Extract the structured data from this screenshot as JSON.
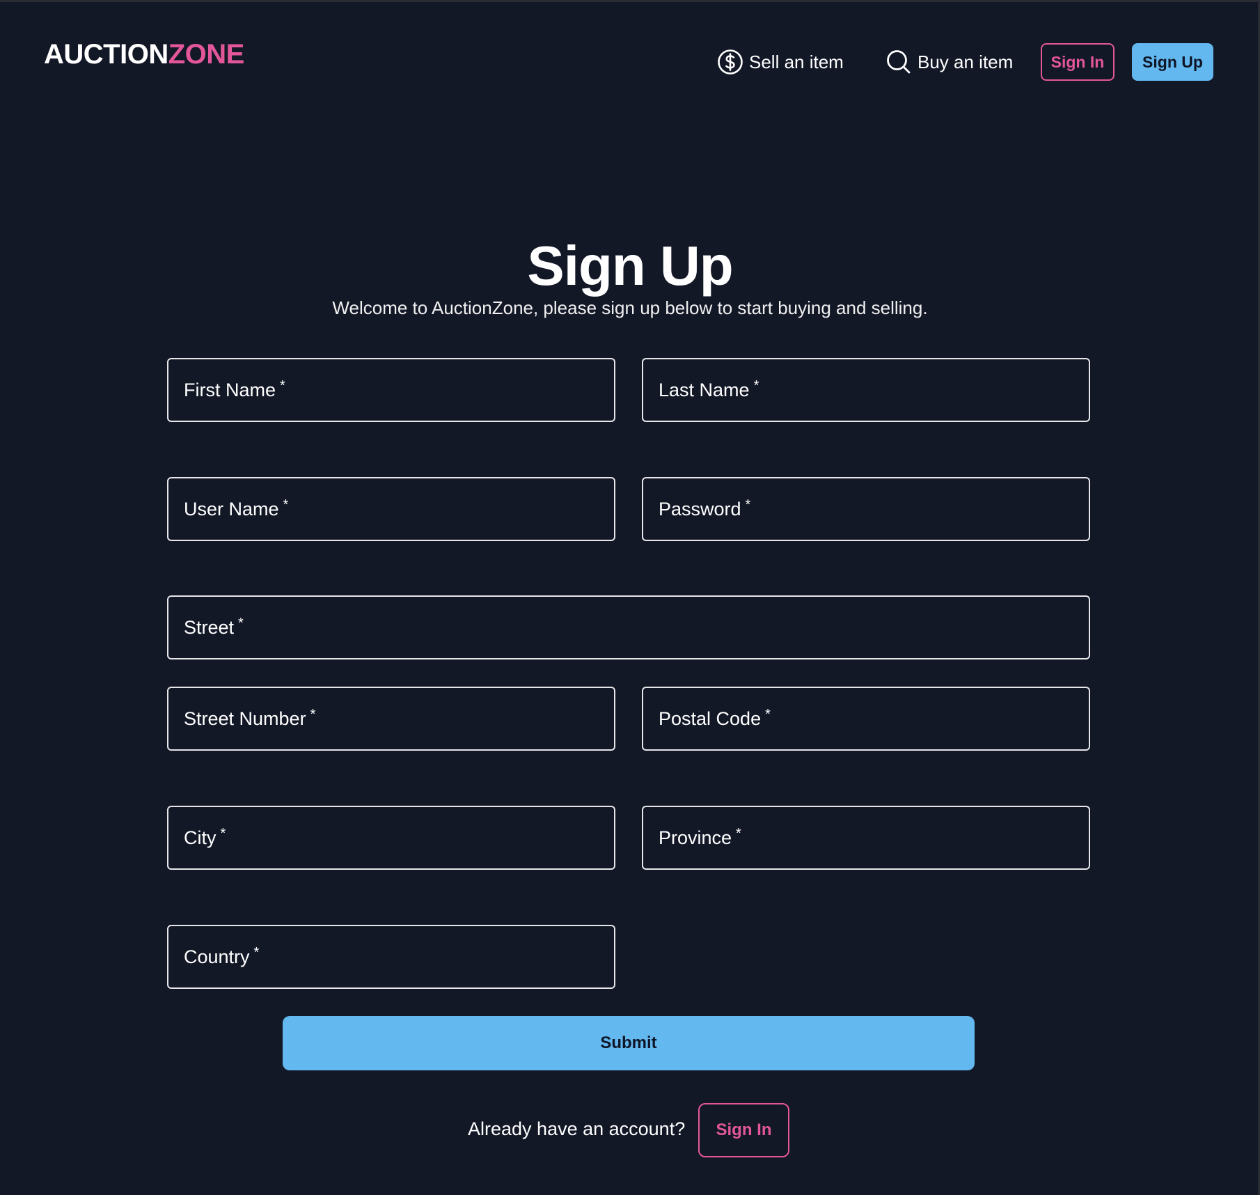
{
  "header": {
    "logo_part1": "AUCTION",
    "logo_part2": "ZONE",
    "nav": {
      "sell_label": "Sell an item",
      "buy_label": "Buy an item",
      "signin_label": "Sign In",
      "signup_label": "Sign Up"
    },
    "icons": {
      "sell": "dollar-circle-icon",
      "buy": "search-icon"
    }
  },
  "main": {
    "title": "Sign Up",
    "subtitle": "Welcome to AuctionZone, please sign up below to start buying and selling.",
    "required_mark": "*",
    "fields": {
      "first_name": "First Name",
      "last_name": "Last Name",
      "user_name": "User Name",
      "password": "Password",
      "street": "Street",
      "street_number": "Street Number",
      "postal_code": "Postal Code",
      "city": "City",
      "province": "Province",
      "country": "Country"
    },
    "submit_label": "Submit",
    "already_text": "Already have an account?",
    "bottom_signin_label": "Sign In"
  },
  "colors": {
    "background": "#131827",
    "accent_pink": "#e3579a",
    "accent_blue": "#63b8ef"
  }
}
